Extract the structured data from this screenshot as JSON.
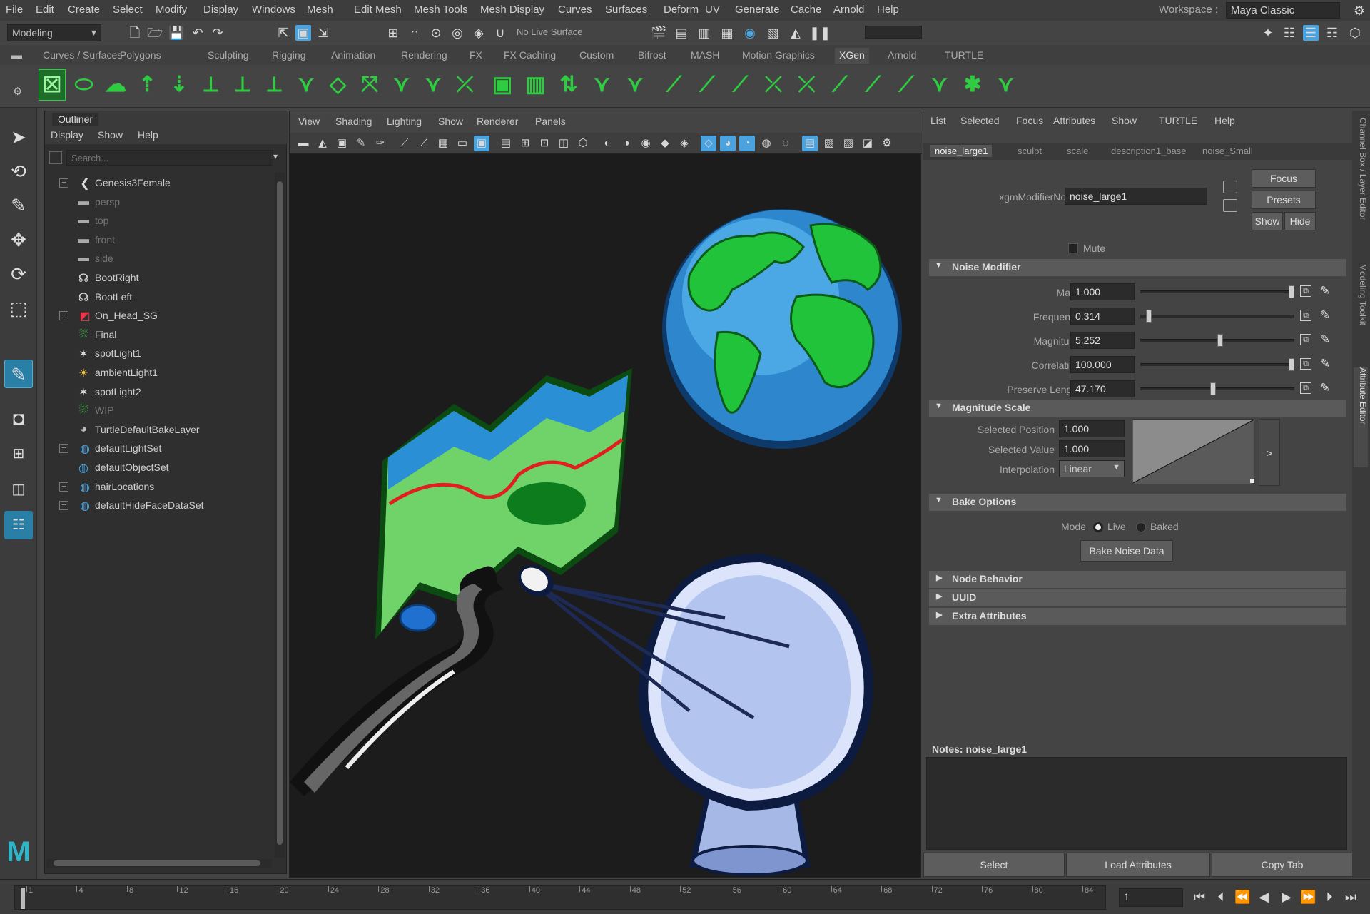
{
  "menubar": {
    "items": [
      "File",
      "Edit",
      "Create",
      "Select",
      "Modify",
      "Display",
      "Windows",
      "Mesh",
      "Edit Mesh",
      "Mesh Tools",
      "Mesh Display",
      "Curves",
      "Surfaces",
      "Deform",
      "UV",
      "Generate",
      "Cache",
      "Arnold",
      "Help"
    ],
    "workspace_label": "Workspace :",
    "workspace_value": "Maya Classic"
  },
  "statusline": {
    "mode": "Modeling",
    "live_surface": "No Live Surface"
  },
  "shelf": {
    "tabs": [
      "Curves / Surfaces",
      "Polygons",
      "Sculpting",
      "Rigging",
      "Animation",
      "Rendering",
      "FX",
      "FX Caching",
      "Custom",
      "Bifrost",
      "MASH",
      "Motion Graphics",
      "XGen",
      "Arnold",
      "TURTLE"
    ],
    "active_tab": "XGen"
  },
  "outliner": {
    "title": "Outliner",
    "menu": [
      "Display",
      "Show",
      "Help"
    ],
    "search_placeholder": "Search...",
    "rows": [
      {
        "label": "Genesis3Female",
        "indent": 0,
        "expand": "+",
        "icon": "joint-icon",
        "dim": false
      },
      {
        "label": "persp",
        "indent": 1,
        "expand": "",
        "icon": "camera-icon",
        "dim": true
      },
      {
        "label": "top",
        "indent": 1,
        "expand": "",
        "icon": "camera-icon",
        "dim": true
      },
      {
        "label": "front",
        "indent": 1,
        "expand": "",
        "icon": "camera-icon",
        "dim": true
      },
      {
        "label": "side",
        "indent": 1,
        "expand": "",
        "icon": "camera-icon",
        "dim": true
      },
      {
        "label": "BootRight",
        "indent": 1,
        "expand": "",
        "icon": "curve-icon",
        "dim": false
      },
      {
        "label": "BootLeft",
        "indent": 1,
        "expand": "",
        "icon": "curve-icon",
        "dim": false
      },
      {
        "label": "On_Head_SG",
        "indent": 0,
        "expand": "+",
        "icon": "shading-group-icon",
        "dim": false
      },
      {
        "label": "Final",
        "indent": 1,
        "expand": "",
        "icon": "xgen-description-icon",
        "dim": false
      },
      {
        "label": "spotLight1",
        "indent": 1,
        "expand": "",
        "icon": "spot-light-icon",
        "dim": false
      },
      {
        "label": "ambientLight1",
        "indent": 1,
        "expand": "",
        "icon": "ambient-light-icon",
        "dim": false
      },
      {
        "label": "spotLight2",
        "indent": 1,
        "expand": "",
        "icon": "spot-light-icon",
        "dim": false
      },
      {
        "label": "WIP",
        "indent": 1,
        "expand": "",
        "icon": "xgen-description-icon",
        "dim": true
      },
      {
        "label": "TurtleDefaultBakeLayer",
        "indent": 1,
        "expand": "",
        "icon": "bake-layer-icon",
        "dim": false
      },
      {
        "label": "defaultLightSet",
        "indent": 0,
        "expand": "+",
        "icon": "set-icon",
        "dim": false
      },
      {
        "label": "defaultObjectSet",
        "indent": 1,
        "expand": "",
        "icon": "set-icon",
        "dim": false
      },
      {
        "label": "hairLocations",
        "indent": 0,
        "expand": "+",
        "icon": "set-icon",
        "dim": false
      },
      {
        "label": "defaultHideFaceDataSet",
        "indent": 0,
        "expand": "+",
        "icon": "set-icon",
        "dim": false
      }
    ]
  },
  "viewport": {
    "menu": [
      "View",
      "Shading",
      "Lighting",
      "Show",
      "Renderer",
      "Panels"
    ]
  },
  "attribute_editor": {
    "menu": [
      "List",
      "Selected",
      "Focus",
      "Attributes",
      "Show",
      "TURTLE",
      "Help"
    ],
    "tabs": [
      "noise_large1",
      "sculpt",
      "scale",
      "description1_base",
      "noise_Small"
    ],
    "active_tab": "noise_large1",
    "node_label": "xgmModifierNoise:",
    "node_value": "noise_large1",
    "focus_button": "Focus",
    "presets_button": "Presets",
    "show_button": "Show",
    "hide_button": "Hide",
    "mute_label": "Mute",
    "noise_section": "Noise Modifier",
    "noise_fields": [
      {
        "label": "Mask",
        "value": "1.000",
        "slider": 1.0
      },
      {
        "label": "Frequency",
        "value": "0.314",
        "slider": 0.04
      },
      {
        "label": "Magnitude",
        "value": "5.252",
        "slider": 0.52
      },
      {
        "label": "Correlation",
        "value": "100.000",
        "slider": 1.0
      },
      {
        "label": "Preserve Length",
        "value": "47.170",
        "slider": 0.47
      }
    ],
    "magnitude_section": "Magnitude Scale",
    "selected_position_label": "Selected Position",
    "selected_position_value": "1.000",
    "selected_value_label": "Selected Value",
    "selected_value_value": "1.000",
    "interpolation_label": "Interpolation",
    "interpolation_value": "Linear",
    "ramp_arrow": ">",
    "bake_section": "Bake Options",
    "mode_label": "Mode",
    "mode_live": "Live",
    "mode_baked": "Baked",
    "bake_button": "Bake Noise Data",
    "node_behavior": "Node Behavior",
    "uuid": "UUID",
    "extra_attributes": "Extra Attributes",
    "notes_label": "Notes:  noise_large1",
    "select_button": "Select",
    "load_attributes_button": "Load Attributes",
    "copy_tab_button": "Copy Tab"
  },
  "side_tabs": [
    "Channel Box / Layer Editor",
    "Modeling Toolkit",
    "Attribute Editor"
  ],
  "timeline": {
    "ticks": [
      "1",
      "4",
      "8",
      "12",
      "16",
      "20",
      "24",
      "28",
      "32",
      "36",
      "40",
      "44",
      "48",
      "52",
      "56",
      "60",
      "64",
      "68",
      "72",
      "76",
      "80",
      "84"
    ],
    "current_frame": "1"
  },
  "colors": {
    "accent_blue": "#4aa3df",
    "xgen_green": "#2ecc40",
    "maya_logo": "#2fb5c8"
  }
}
